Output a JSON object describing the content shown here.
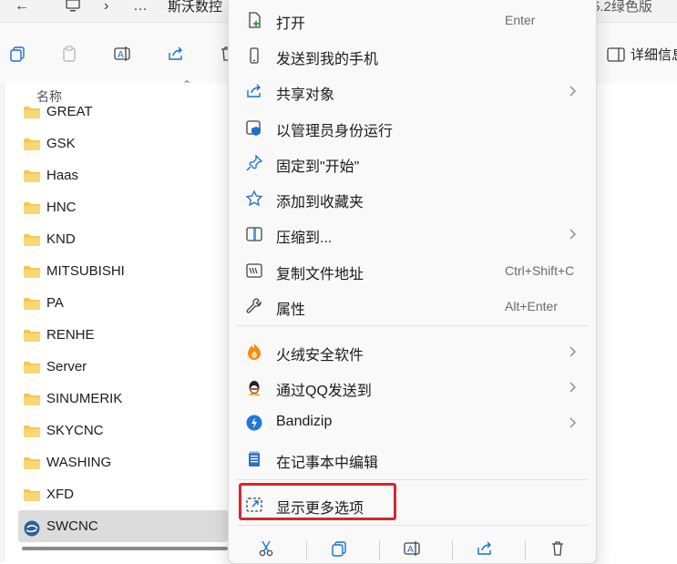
{
  "titlebar": {
    "title_partial": "斯沃数控",
    "right_partial": "5.2绿色版"
  },
  "toolbar": {
    "details_label": "详细信息"
  },
  "file_list": {
    "column_header": "名称",
    "items": [
      {
        "name": "GREAT",
        "type": "folder"
      },
      {
        "name": "GSK",
        "type": "folder"
      },
      {
        "name": "Haas",
        "type": "folder"
      },
      {
        "name": "HNC",
        "type": "folder"
      },
      {
        "name": "KND",
        "type": "folder"
      },
      {
        "name": "MITSUBISHI",
        "type": "folder"
      },
      {
        "name": "PA",
        "type": "folder"
      },
      {
        "name": "RENHE",
        "type": "folder"
      },
      {
        "name": "Server",
        "type": "folder"
      },
      {
        "name": "SINUMERIK",
        "type": "folder"
      },
      {
        "name": "SKYCNC",
        "type": "folder"
      },
      {
        "name": "WASHING",
        "type": "folder"
      },
      {
        "name": "XFD",
        "type": "folder"
      },
      {
        "name": "SWCNC",
        "type": "application",
        "selected": true
      }
    ]
  },
  "context_menu": {
    "items": [
      {
        "label": "打开",
        "shortcut": "Enter",
        "icon": "open-icon"
      },
      {
        "label": "发送到我的手机",
        "icon": "phone-icon"
      },
      {
        "label": "共享对象",
        "icon": "share-icon",
        "submenu": true
      },
      {
        "label": "以管理员身份运行",
        "icon": "admin-shield-icon"
      },
      {
        "label": "固定到\"开始\"",
        "icon": "pin-icon"
      },
      {
        "label": "添加到收藏夹",
        "icon": "star-icon"
      },
      {
        "label": "压缩到...",
        "icon": "zip-icon",
        "submenu": true
      },
      {
        "label": "复制文件地址",
        "shortcut": "Ctrl+Shift+C",
        "icon": "copy-path-icon"
      },
      {
        "label": "属性",
        "shortcut": "Alt+Enter",
        "icon": "wrench-icon"
      },
      {
        "label": "火绒安全软件",
        "icon": "huorong-icon",
        "submenu": true
      },
      {
        "label": "通过QQ发送到",
        "icon": "qq-icon",
        "submenu": true
      },
      {
        "label": "Bandizip",
        "icon": "bandizip-icon",
        "submenu": true
      },
      {
        "label": "在记事本中编辑",
        "icon": "notepad-icon"
      },
      {
        "label": "显示更多选项",
        "icon": "more-options-icon",
        "highlighted": true
      }
    ],
    "bottom_actions": [
      "cut-icon",
      "copy-icon",
      "rename-icon",
      "share-icon",
      "delete-icon"
    ],
    "highlight_color": "#d9262c"
  }
}
